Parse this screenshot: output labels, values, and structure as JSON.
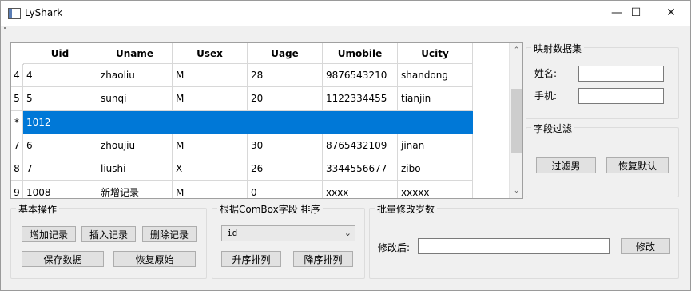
{
  "window": {
    "title": "LyShark",
    "minimize": "—",
    "maximize": "☐",
    "close": "✕"
  },
  "table": {
    "columns": [
      "Uid",
      "Uname",
      "Usex",
      "Uage",
      "Umobile",
      "Ucity"
    ],
    "rows": [
      {
        "header": "4",
        "cells": [
          "4",
          "zhaoliu",
          "M",
          "28",
          "9876543210",
          "shandong"
        ],
        "selected": false
      },
      {
        "header": "5",
        "cells": [
          "5",
          "sunqi",
          "M",
          "20",
          "1122334455",
          "tianjin"
        ],
        "selected": false
      },
      {
        "header": "*",
        "cells": [
          "1012",
          "",
          "",
          "",
          "",
          ""
        ],
        "selected": true
      },
      {
        "header": "7",
        "cells": [
          "6",
          "zhoujiu",
          "M",
          "30",
          "8765432109",
          "jinan"
        ],
        "selected": false
      },
      {
        "header": "8",
        "cells": [
          "7",
          "liushi",
          "X",
          "26",
          "3344556677",
          "zibo"
        ],
        "selected": false
      },
      {
        "header": "9",
        "cells": [
          "1008",
          "新增记录",
          "M",
          "0",
          "xxxx",
          "xxxxx"
        ],
        "selected": false
      }
    ],
    "selection_color": "#0078d7"
  },
  "mapping": {
    "title": "映射数据集",
    "name_label": "姓名:",
    "name_value": "",
    "mobile_label": "手机:",
    "mobile_value": ""
  },
  "filter": {
    "title": "字段过滤",
    "filter_male_label": "过滤男",
    "restore_default_label": "恢复默认"
  },
  "basic": {
    "title": "基本操作",
    "add_label": "增加记录",
    "insert_label": "插入记录",
    "delete_label": "删除记录",
    "save_label": "保存数据",
    "restore_label": "恢复原始"
  },
  "sort": {
    "title": "根据ComBox字段 排序",
    "field_value": "id",
    "asc_label": "升序排列",
    "desc_label": "降序排列"
  },
  "batch": {
    "title": "批量修改岁数",
    "after_label": "修改后:",
    "after_value": "",
    "modify_label": "修改"
  }
}
